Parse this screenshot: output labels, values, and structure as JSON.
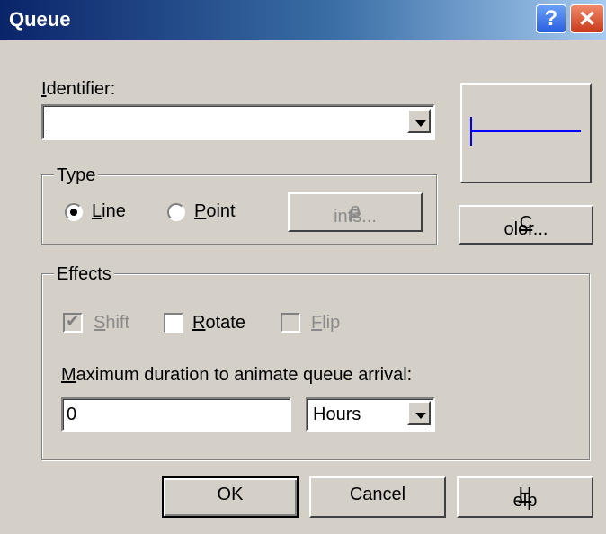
{
  "window": {
    "title": "Queue",
    "help_icon": "?",
    "close_icon": "✕"
  },
  "identifier": {
    "label_key": "I",
    "label_rest": "dentifier:",
    "value": ""
  },
  "type_group": {
    "label": "Type",
    "line": {
      "key": "L",
      "rest": "ine",
      "selected": true
    },
    "point": {
      "key": "P",
      "rest": "oint",
      "selected": false
    },
    "points_button": {
      "pre": "P",
      "key": "o",
      "rest": "ints..."
    }
  },
  "color_button": {
    "key": "C",
    "rest": "olor..."
  },
  "effects_group": {
    "label": "Effects",
    "shift": {
      "key": "S",
      "rest": "hift",
      "checked": true,
      "enabled": false
    },
    "rotate": {
      "key": "R",
      "rest": "otate",
      "checked": false,
      "enabled": true
    },
    "flip": {
      "key": "F",
      "rest": "lip",
      "checked": false,
      "enabled": false
    }
  },
  "duration": {
    "label_key": "M",
    "label_rest": "aximum duration to animate queue arrival:",
    "value": "0",
    "unit": "Hours"
  },
  "buttons": {
    "ok": "OK",
    "cancel": "Cancel",
    "help_key": "H",
    "help_rest": "elp"
  },
  "colors": {
    "preview_line": "#0000ff",
    "title_start": "#0a246a",
    "face": "#d4d0c8"
  }
}
